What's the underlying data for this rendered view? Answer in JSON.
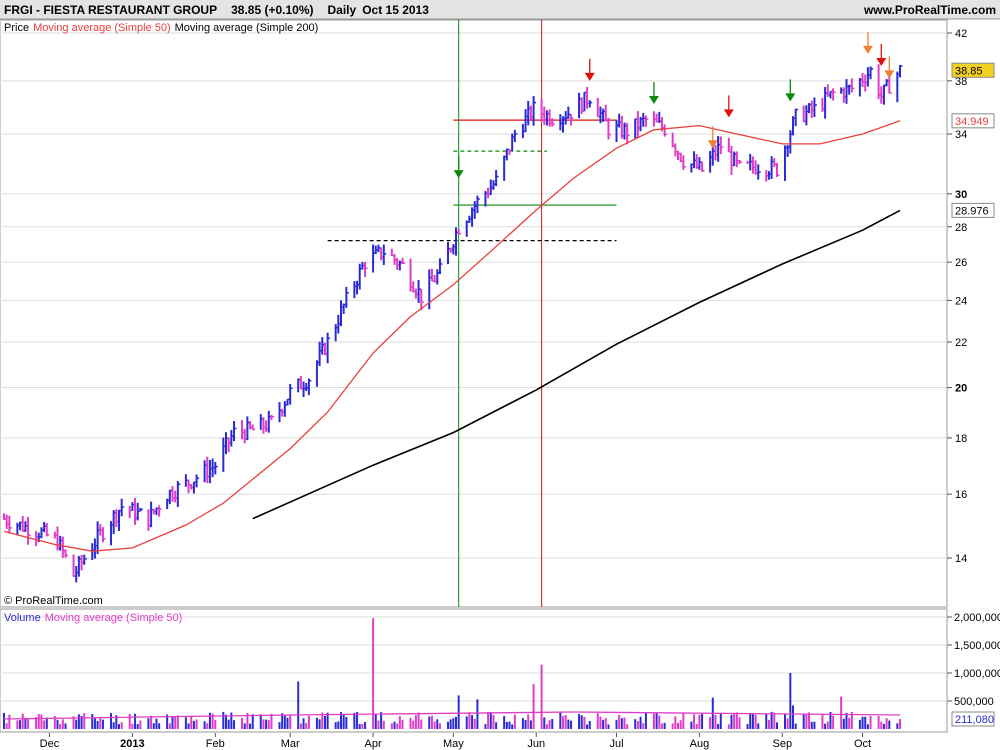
{
  "header": {
    "symbol_title": "FRGI - FIESTA RESTAURANT GROUP",
    "quote": "38.85 (+0.10%)",
    "period": "Daily",
    "date": "Oct 15 2013",
    "site": "www.ProRealTime.com"
  },
  "legend": {
    "price": "Price",
    "ma50": "Moving average (Simple 50)",
    "ma200": "Moving average (Simple 200)"
  },
  "copyright": "© ProRealTime.com",
  "volume_legend": {
    "volume": "Volume",
    "ma50": "Moving average (Simple 50)"
  },
  "colors": {
    "up_bar": "#2b2bd6",
    "down_bar": "#e03cc8",
    "ma50": "#e8403c",
    "ma200": "#000000",
    "green_marker": "#0a8a0a",
    "red_marker": "#e01010",
    "orange_marker": "#f08030"
  },
  "chart_data": {
    "type": "ohlc",
    "y_axis": {
      "scale": "log",
      "ticks": [
        14,
        16,
        18,
        20,
        22,
        24,
        26,
        28,
        30,
        34,
        38,
        42
      ],
      "tick_labels": [
        "14",
        "16",
        "18",
        "20",
        "22",
        "24",
        "26",
        "28",
        "30",
        "34",
        "38",
        "42"
      ],
      "badges": [
        {
          "value": 38.85,
          "label": "38.85",
          "series": "price"
        },
        {
          "value": 34.949,
          "label": "34.949",
          "series": "ma50"
        },
        {
          "value": 28.976,
          "label": "28.976",
          "series": "ma200"
        }
      ]
    },
    "x_axis": {
      "tick_labels": [
        {
          "label": "Dec",
          "date": "2012-12-01"
        },
        {
          "label": "2013",
          "date": "2013-01-01"
        },
        {
          "label": "Feb",
          "date": "2013-02-01"
        },
        {
          "label": "Mar",
          "date": "2013-03-01"
        },
        {
          "label": "Apr",
          "date": "2013-04-01"
        },
        {
          "label": "May",
          "date": "2013-05-01"
        },
        {
          "label": "Jun",
          "date": "2013-06-01"
        },
        {
          "label": "Jul",
          "date": "2013-07-01"
        },
        {
          "label": "Aug",
          "date": "2013-08-01"
        },
        {
          "label": "Sep",
          "date": "2013-09-01"
        },
        {
          "label": "Oct",
          "date": "2013-10-01"
        }
      ]
    },
    "price_path": [
      {
        "date": "2012-11-14",
        "close": 15.2
      },
      {
        "date": "2012-11-20",
        "close": 15.0
      },
      {
        "date": "2012-11-27",
        "close": 14.8
      },
      {
        "date": "2012-12-04",
        "close": 14.5
      },
      {
        "date": "2012-12-10",
        "close": 13.5
      },
      {
        "date": "2012-12-14",
        "close": 14.0
      },
      {
        "date": "2012-12-19",
        "close": 14.6
      },
      {
        "date": "2012-12-28",
        "close": 15.6
      },
      {
        "date": "2013-01-07",
        "close": 15.2
      },
      {
        "date": "2013-01-14",
        "close": 16.0
      },
      {
        "date": "2013-01-22",
        "close": 16.4
      },
      {
        "date": "2013-02-01",
        "close": 17.0
      },
      {
        "date": "2013-02-08",
        "close": 18.2
      },
      {
        "date": "2013-02-15",
        "close": 18.3
      },
      {
        "date": "2013-02-22",
        "close": 18.6
      },
      {
        "date": "2013-03-01",
        "close": 19.8
      },
      {
        "date": "2013-03-08",
        "close": 20.4
      },
      {
        "date": "2013-03-15",
        "close": 22.0
      },
      {
        "date": "2013-03-22",
        "close": 24.0
      },
      {
        "date": "2013-03-29",
        "close": 26.0
      },
      {
        "date": "2013-04-05",
        "close": 26.6
      },
      {
        "date": "2013-04-12",
        "close": 25.8
      },
      {
        "date": "2013-04-19",
        "close": 24.2
      },
      {
        "date": "2013-04-26",
        "close": 25.5
      },
      {
        "date": "2013-05-03",
        "close": 28.0
      },
      {
        "date": "2013-05-10",
        "close": 29.5
      },
      {
        "date": "2013-05-17",
        "close": 30.8
      },
      {
        "date": "2013-05-24",
        "close": 34.0
      },
      {
        "date": "2013-05-31",
        "close": 35.8
      },
      {
        "date": "2013-06-07",
        "close": 35.2
      },
      {
        "date": "2013-06-14",
        "close": 35.6
      },
      {
        "date": "2013-06-21",
        "close": 36.8
      },
      {
        "date": "2013-06-28",
        "close": 34.4
      },
      {
        "date": "2013-07-05",
        "close": 34.2
      },
      {
        "date": "2013-07-12",
        "close": 35.0
      },
      {
        "date": "2013-07-19",
        "close": 34.4
      },
      {
        "date": "2013-07-26",
        "close": 32.2
      },
      {
        "date": "2013-08-02",
        "close": 31.5
      },
      {
        "date": "2013-08-09",
        "close": 33.2
      },
      {
        "date": "2013-08-16",
        "close": 31.6
      },
      {
        "date": "2013-08-23",
        "close": 31.8
      },
      {
        "date": "2013-08-30",
        "close": 31.6
      },
      {
        "date": "2013-09-06",
        "close": 35.2
      },
      {
        "date": "2013-09-13",
        "close": 35.8
      },
      {
        "date": "2013-09-20",
        "close": 37.0
      },
      {
        "date": "2013-09-27",
        "close": 37.4
      },
      {
        "date": "2013-10-04",
        "close": 38.8
      },
      {
        "date": "2013-10-08",
        "close": 36.8
      },
      {
        "date": "2013-10-15",
        "close": 38.85
      }
    ],
    "series": [
      {
        "name": "Moving average (Simple 50)",
        "points": [
          {
            "date": "2012-11-14",
            "value": 14.8
          },
          {
            "date": "2012-12-03",
            "value": 14.4
          },
          {
            "date": "2012-12-17",
            "value": 14.2
          },
          {
            "date": "2013-01-01",
            "value": 14.3
          },
          {
            "date": "2013-01-21",
            "value": 15.0
          },
          {
            "date": "2013-02-04",
            "value": 15.7
          },
          {
            "date": "2013-03-01",
            "value": 17.6
          },
          {
            "date": "2013-03-15",
            "value": 19.0
          },
          {
            "date": "2013-04-01",
            "value": 21.5
          },
          {
            "date": "2013-04-15",
            "value": 23.2
          },
          {
            "date": "2013-05-01",
            "value": 24.8
          },
          {
            "date": "2013-05-15",
            "value": 26.6
          },
          {
            "date": "2013-06-01",
            "value": 29.0
          },
          {
            "date": "2013-06-15",
            "value": 31.0
          },
          {
            "date": "2013-07-01",
            "value": 33.0
          },
          {
            "date": "2013-07-15",
            "value": 34.3
          },
          {
            "date": "2013-08-01",
            "value": 34.6
          },
          {
            "date": "2013-08-15",
            "value": 34.0
          },
          {
            "date": "2013-09-01",
            "value": 33.3
          },
          {
            "date": "2013-09-15",
            "value": 33.3
          },
          {
            "date": "2013-10-01",
            "value": 34.0
          },
          {
            "date": "2013-10-15",
            "value": 34.949
          }
        ]
      },
      {
        "name": "Moving average (Simple 200)",
        "points": [
          {
            "date": "2013-02-15",
            "value": 15.2
          },
          {
            "date": "2013-04-01",
            "value": 17.0
          },
          {
            "date": "2013-05-01",
            "value": 18.2
          },
          {
            "date": "2013-06-01",
            "value": 19.9
          },
          {
            "date": "2013-07-01",
            "value": 21.9
          },
          {
            "date": "2013-08-01",
            "value": 23.9
          },
          {
            "date": "2013-09-01",
            "value": 25.9
          },
          {
            "date": "2013-10-01",
            "value": 27.8
          },
          {
            "date": "2013-10-15",
            "value": 28.976
          }
        ]
      }
    ],
    "markers": [
      {
        "date": "2013-05-03",
        "type": "down-arrow",
        "color": "green",
        "price": 31.0
      },
      {
        "date": "2013-06-21",
        "type": "down-arrow",
        "color": "red",
        "price": 38.0
      },
      {
        "date": "2013-07-15",
        "type": "down-arrow",
        "color": "green",
        "price": 36.2
      },
      {
        "date": "2013-08-06",
        "type": "down-arrow",
        "color": "orange",
        "price": 33.0
      },
      {
        "date": "2013-08-12",
        "type": "down-arrow",
        "color": "red",
        "price": 35.2
      },
      {
        "date": "2013-09-04",
        "type": "down-arrow",
        "color": "green",
        "price": 36.4
      },
      {
        "date": "2013-10-03",
        "type": "down-arrow",
        "color": "orange",
        "price": 40.2
      },
      {
        "date": "2013-10-08",
        "type": "down-arrow",
        "color": "red",
        "price": 39.2
      },
      {
        "date": "2013-10-11",
        "type": "down-arrow",
        "color": "orange",
        "price": 38.2
      }
    ],
    "reference_lines": [
      {
        "kind": "vertical",
        "date": "2013-05-03",
        "color": "green"
      },
      {
        "kind": "vertical",
        "date": "2013-06-03",
        "color": "red"
      },
      {
        "kind": "horizontal",
        "value": 35.0,
        "from": "2013-05-01",
        "to": "2013-07-01",
        "style": "solid",
        "color": "red"
      },
      {
        "kind": "horizontal",
        "value": 32.8,
        "from": "2013-05-01",
        "to": "2013-06-05",
        "style": "dashed",
        "color": "green"
      },
      {
        "kind": "horizontal",
        "value": 29.3,
        "from": "2013-05-01",
        "to": "2013-07-01",
        "style": "solid",
        "color": "green"
      },
      {
        "kind": "horizontal",
        "value": 27.2,
        "from": "2013-03-15",
        "to": "2013-07-01",
        "style": "dashed",
        "color": "black"
      }
    ],
    "volume": {
      "ylim": [
        0,
        2000000
      ],
      "ticks": [
        500000,
        1000000,
        1500000,
        2000000
      ],
      "tick_labels": [
        "500,000",
        "1,000,000",
        "1,500,000",
        "2,000,000"
      ],
      "last_value_label": "211,080",
      "ma50_level": 250000,
      "spikes": [
        {
          "date": "2013-03-04",
          "value": 850000
        },
        {
          "date": "2013-04-01",
          "value": 1980000
        },
        {
          "date": "2013-05-03",
          "value": 600000
        },
        {
          "date": "2013-05-10",
          "value": 530000
        },
        {
          "date": "2013-06-03",
          "value": 1150000
        },
        {
          "date": "2013-05-31",
          "value": 800000
        },
        {
          "date": "2013-08-06",
          "value": 560000
        },
        {
          "date": "2013-09-04",
          "value": 1000000
        },
        {
          "date": "2013-09-23",
          "value": 580000
        },
        {
          "date": "2013-09-05",
          "value": 420000
        }
      ]
    }
  }
}
